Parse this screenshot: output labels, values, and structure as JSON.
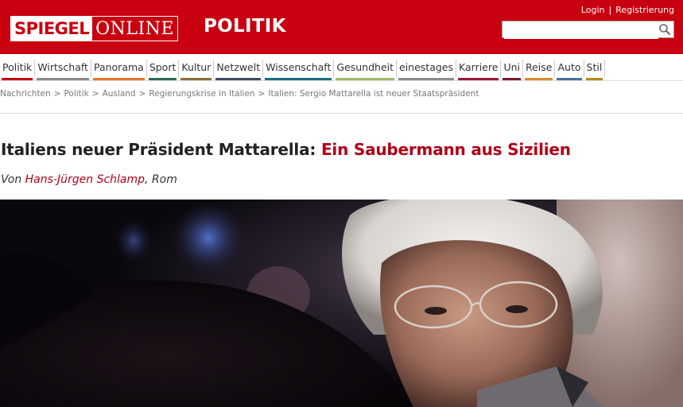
{
  "header": {
    "logo_left": "SPIEGEL",
    "logo_right": "ONLINE",
    "section": "POLITIK",
    "login": "Login",
    "separator": "|",
    "register": "Registrierung",
    "search_placeholder": ""
  },
  "nav": {
    "items": [
      {
        "label": "Politik",
        "color": "#c8000f",
        "active": true
      },
      {
        "label": "Wirtschaft",
        "color": "#8a8a8a"
      },
      {
        "label": "Panorama",
        "color": "#e7772a"
      },
      {
        "label": "Sport",
        "color": "#2d6b58"
      },
      {
        "label": "Kultur",
        "color": "#8b6b3a"
      },
      {
        "label": "Netzwelt",
        "color": "#3e4d5e"
      },
      {
        "label": "Wissenschaft",
        "color": "#1d6d80"
      },
      {
        "label": "Gesundheit",
        "color": "#9fb86e"
      },
      {
        "label": "einestages",
        "color": "#8c8c8c"
      },
      {
        "label": "Karriere",
        "color": "#a0173b"
      },
      {
        "label": "Uni",
        "color": "#7a1b3a"
      },
      {
        "label": "Reise",
        "color": "#d98b2b"
      },
      {
        "label": "Auto",
        "color": "#4b6f97"
      },
      {
        "label": "Stil",
        "color": "#b6881e"
      }
    ]
  },
  "breadcrumb": {
    "items": [
      "Nachrichten",
      "Politik",
      "Ausland",
      "Regierungskrise in Italien",
      "Italien: Sergio Mattarella ist neuer Staatspräsident"
    ],
    "separator": ">"
  },
  "article": {
    "headline_prefix": "Italiens neuer Präsident Mattarella:",
    "headline_highlight": "Ein Saubermann aus Sizilien",
    "byline_prefix": "Von",
    "author": "Hans-Jürgen Schlamp",
    "byline_suffix": ", Rom"
  },
  "colors": {
    "brand_red": "#c8000f",
    "headline_red": "#b00018"
  }
}
